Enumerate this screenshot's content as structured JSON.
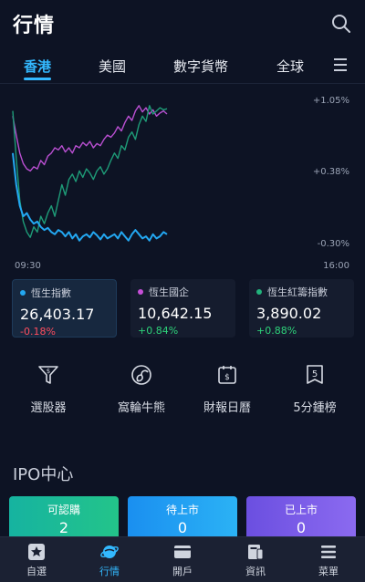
{
  "header": {
    "title": "行情"
  },
  "tabs": [
    {
      "label": "香港",
      "active": true
    },
    {
      "label": "美國",
      "active": false
    },
    {
      "label": "數字貨幣",
      "active": false
    },
    {
      "label": "全球",
      "active": false
    }
  ],
  "chart_data": {
    "type": "line",
    "x_labels": [
      "09:30",
      "16:00"
    ],
    "y_ticks": [
      "+1.05%",
      "+0.38%",
      "-0.30%"
    ],
    "ylim": [
      -0.3,
      1.05
    ],
    "series": [
      {
        "color": "#b94fd1",
        "values": [
          0.9,
          0.72,
          0.55,
          0.45,
          0.4,
          0.38,
          0.42,
          0.4,
          0.48,
          0.44,
          0.52,
          0.55,
          0.6,
          0.58,
          0.62,
          0.56,
          0.6,
          0.55,
          0.62,
          0.6,
          0.65,
          0.62,
          0.66,
          0.6,
          0.64,
          0.62,
          0.68,
          0.72,
          0.7,
          0.74,
          0.8,
          0.76,
          0.84,
          0.9,
          0.86,
          0.95,
          1.0,
          0.94,
          0.98,
          0.92,
          0.96,
          0.9,
          0.93,
          0.95,
          0.92
        ]
      },
      {
        "color": "#1e9c78",
        "values": [
          0.95,
          0.5,
          0.1,
          -0.1,
          -0.2,
          -0.25,
          -0.15,
          -0.2,
          -0.05,
          -0.12,
          -0.02,
          0.05,
          -0.05,
          0.1,
          0.25,
          0.15,
          0.3,
          0.35,
          0.28,
          0.38,
          0.32,
          0.4,
          0.36,
          0.3,
          0.38,
          0.42,
          0.35,
          0.4,
          0.48,
          0.55,
          0.5,
          0.62,
          0.58,
          0.7,
          0.75,
          0.68,
          0.82,
          0.9,
          0.85,
          1.0,
          0.92,
          0.95,
          0.98,
          0.96,
          0.97
        ]
      },
      {
        "color": "#23a8f2",
        "values": [
          0.55,
          0.25,
          0.05,
          -0.05,
          -0.02,
          -0.08,
          -0.12,
          -0.1,
          -0.15,
          -0.18,
          -0.16,
          -0.2,
          -0.22,
          -0.18,
          -0.2,
          -0.24,
          -0.2,
          -0.26,
          -0.22,
          -0.28,
          -0.24,
          -0.22,
          -0.25,
          -0.2,
          -0.23,
          -0.27,
          -0.22,
          -0.26,
          -0.24,
          -0.22,
          -0.26,
          -0.2,
          -0.24,
          -0.28,
          -0.22,
          -0.18,
          -0.22,
          -0.26,
          -0.24,
          -0.28,
          -0.22,
          -0.26,
          -0.24,
          -0.2,
          -0.22
        ]
      }
    ]
  },
  "indices": [
    {
      "name": "恆生指數",
      "value": "26,403.17",
      "change": "-0.18%",
      "dir": "neg",
      "dot": "#23a8f2",
      "active": true
    },
    {
      "name": "恆生國企",
      "value": "10,642.15",
      "change": "+0.84%",
      "dir": "pos",
      "dot": "#c64fd8",
      "active": false
    },
    {
      "name": "恆生紅籌指數",
      "value": "3,890.02",
      "change": "+0.88%",
      "dir": "pos",
      "dot": "#22b37c",
      "active": false
    }
  ],
  "tools": [
    {
      "label": "選股器",
      "icon": "funnel-dollar-icon"
    },
    {
      "label": "窩輪牛熊",
      "icon": "swirl-icon"
    },
    {
      "label": "財報日曆",
      "icon": "calendar-dollar-icon"
    },
    {
      "label": "5分鍾榜",
      "icon": "badge-five-icon",
      "glyph": "5"
    }
  ],
  "ipo": {
    "title": "IPO中心",
    "items": [
      {
        "label": "可認購",
        "count": "2",
        "color": "#1fb896"
      },
      {
        "label": "待上市",
        "count": "0",
        "color": "#1f9cf0"
      },
      {
        "label": "已上市",
        "count": "0",
        "color": "#7a5ae8"
      }
    ]
  },
  "nav": [
    {
      "label": "自選",
      "icon": "star-icon",
      "active": false
    },
    {
      "label": "行情",
      "icon": "planet-icon",
      "active": true
    },
    {
      "label": "開戶",
      "icon": "wallet-icon",
      "active": false
    },
    {
      "label": "資訊",
      "icon": "news-icon",
      "active": false
    },
    {
      "label": "菜單",
      "icon": "menu-icon",
      "active": false
    }
  ],
  "colors": {
    "accent": "#33b9ff",
    "background": "#0d1324",
    "negative": "#ff4d5e",
    "positive": "#2ed27a"
  }
}
